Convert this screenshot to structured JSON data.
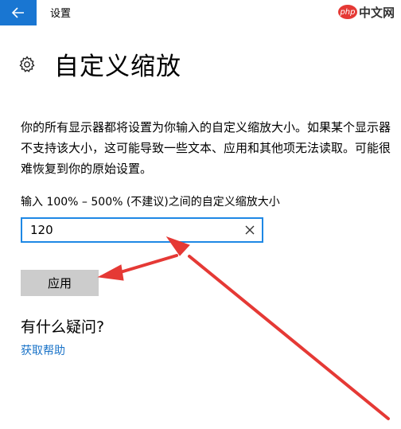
{
  "window": {
    "title": "设置"
  },
  "watermark": {
    "badge": "php",
    "text": "中文网"
  },
  "icons": {
    "back": "back-arrow-icon",
    "gear": "gear-icon",
    "clear": "close-icon"
  },
  "page": {
    "title": "自定义缩放",
    "description": "你的所有显示器都将设置为你输入的自定义缩放大小。如果某个显示器不支持该大小，这可能导致一些文本、应用和其他项无法读取。可能很难恢复到你的原始设置。"
  },
  "scale_input": {
    "label": "输入 100% – 500% (不建议)之间的自定义缩放大小",
    "value": "120"
  },
  "apply_button": {
    "label": "应用"
  },
  "help": {
    "heading": "有什么疑问?",
    "link": "获取帮助"
  },
  "colors": {
    "accent": "#1976d2",
    "button_bg": "#cccccc",
    "link": "#1a73c8",
    "annotation": "#e53935"
  }
}
